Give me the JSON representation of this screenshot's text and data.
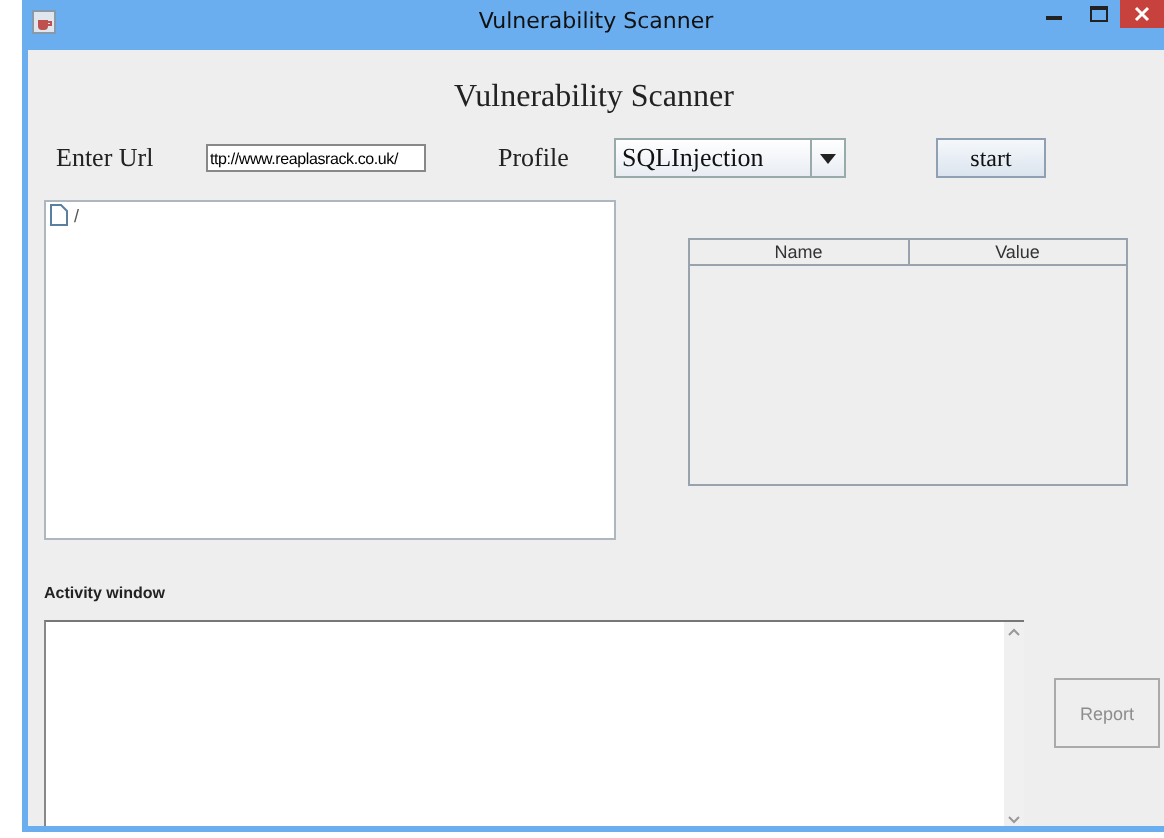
{
  "window": {
    "title": "Vulnerability Scanner"
  },
  "heading": "Vulnerability Scanner",
  "url": {
    "label": "Enter Url",
    "value": "ttp://www.reaplasrack.co.uk/"
  },
  "profile": {
    "label": "Profile",
    "value": "SQLInjection"
  },
  "start_button": {
    "label": "start",
    "disabled": false
  },
  "tree": {
    "items": [
      {
        "label": "/"
      }
    ]
  },
  "table": {
    "columns": [
      "Name",
      "Value"
    ]
  },
  "activity": {
    "label": "Activity window"
  },
  "report_button": {
    "label": "Report",
    "disabled": true
  }
}
